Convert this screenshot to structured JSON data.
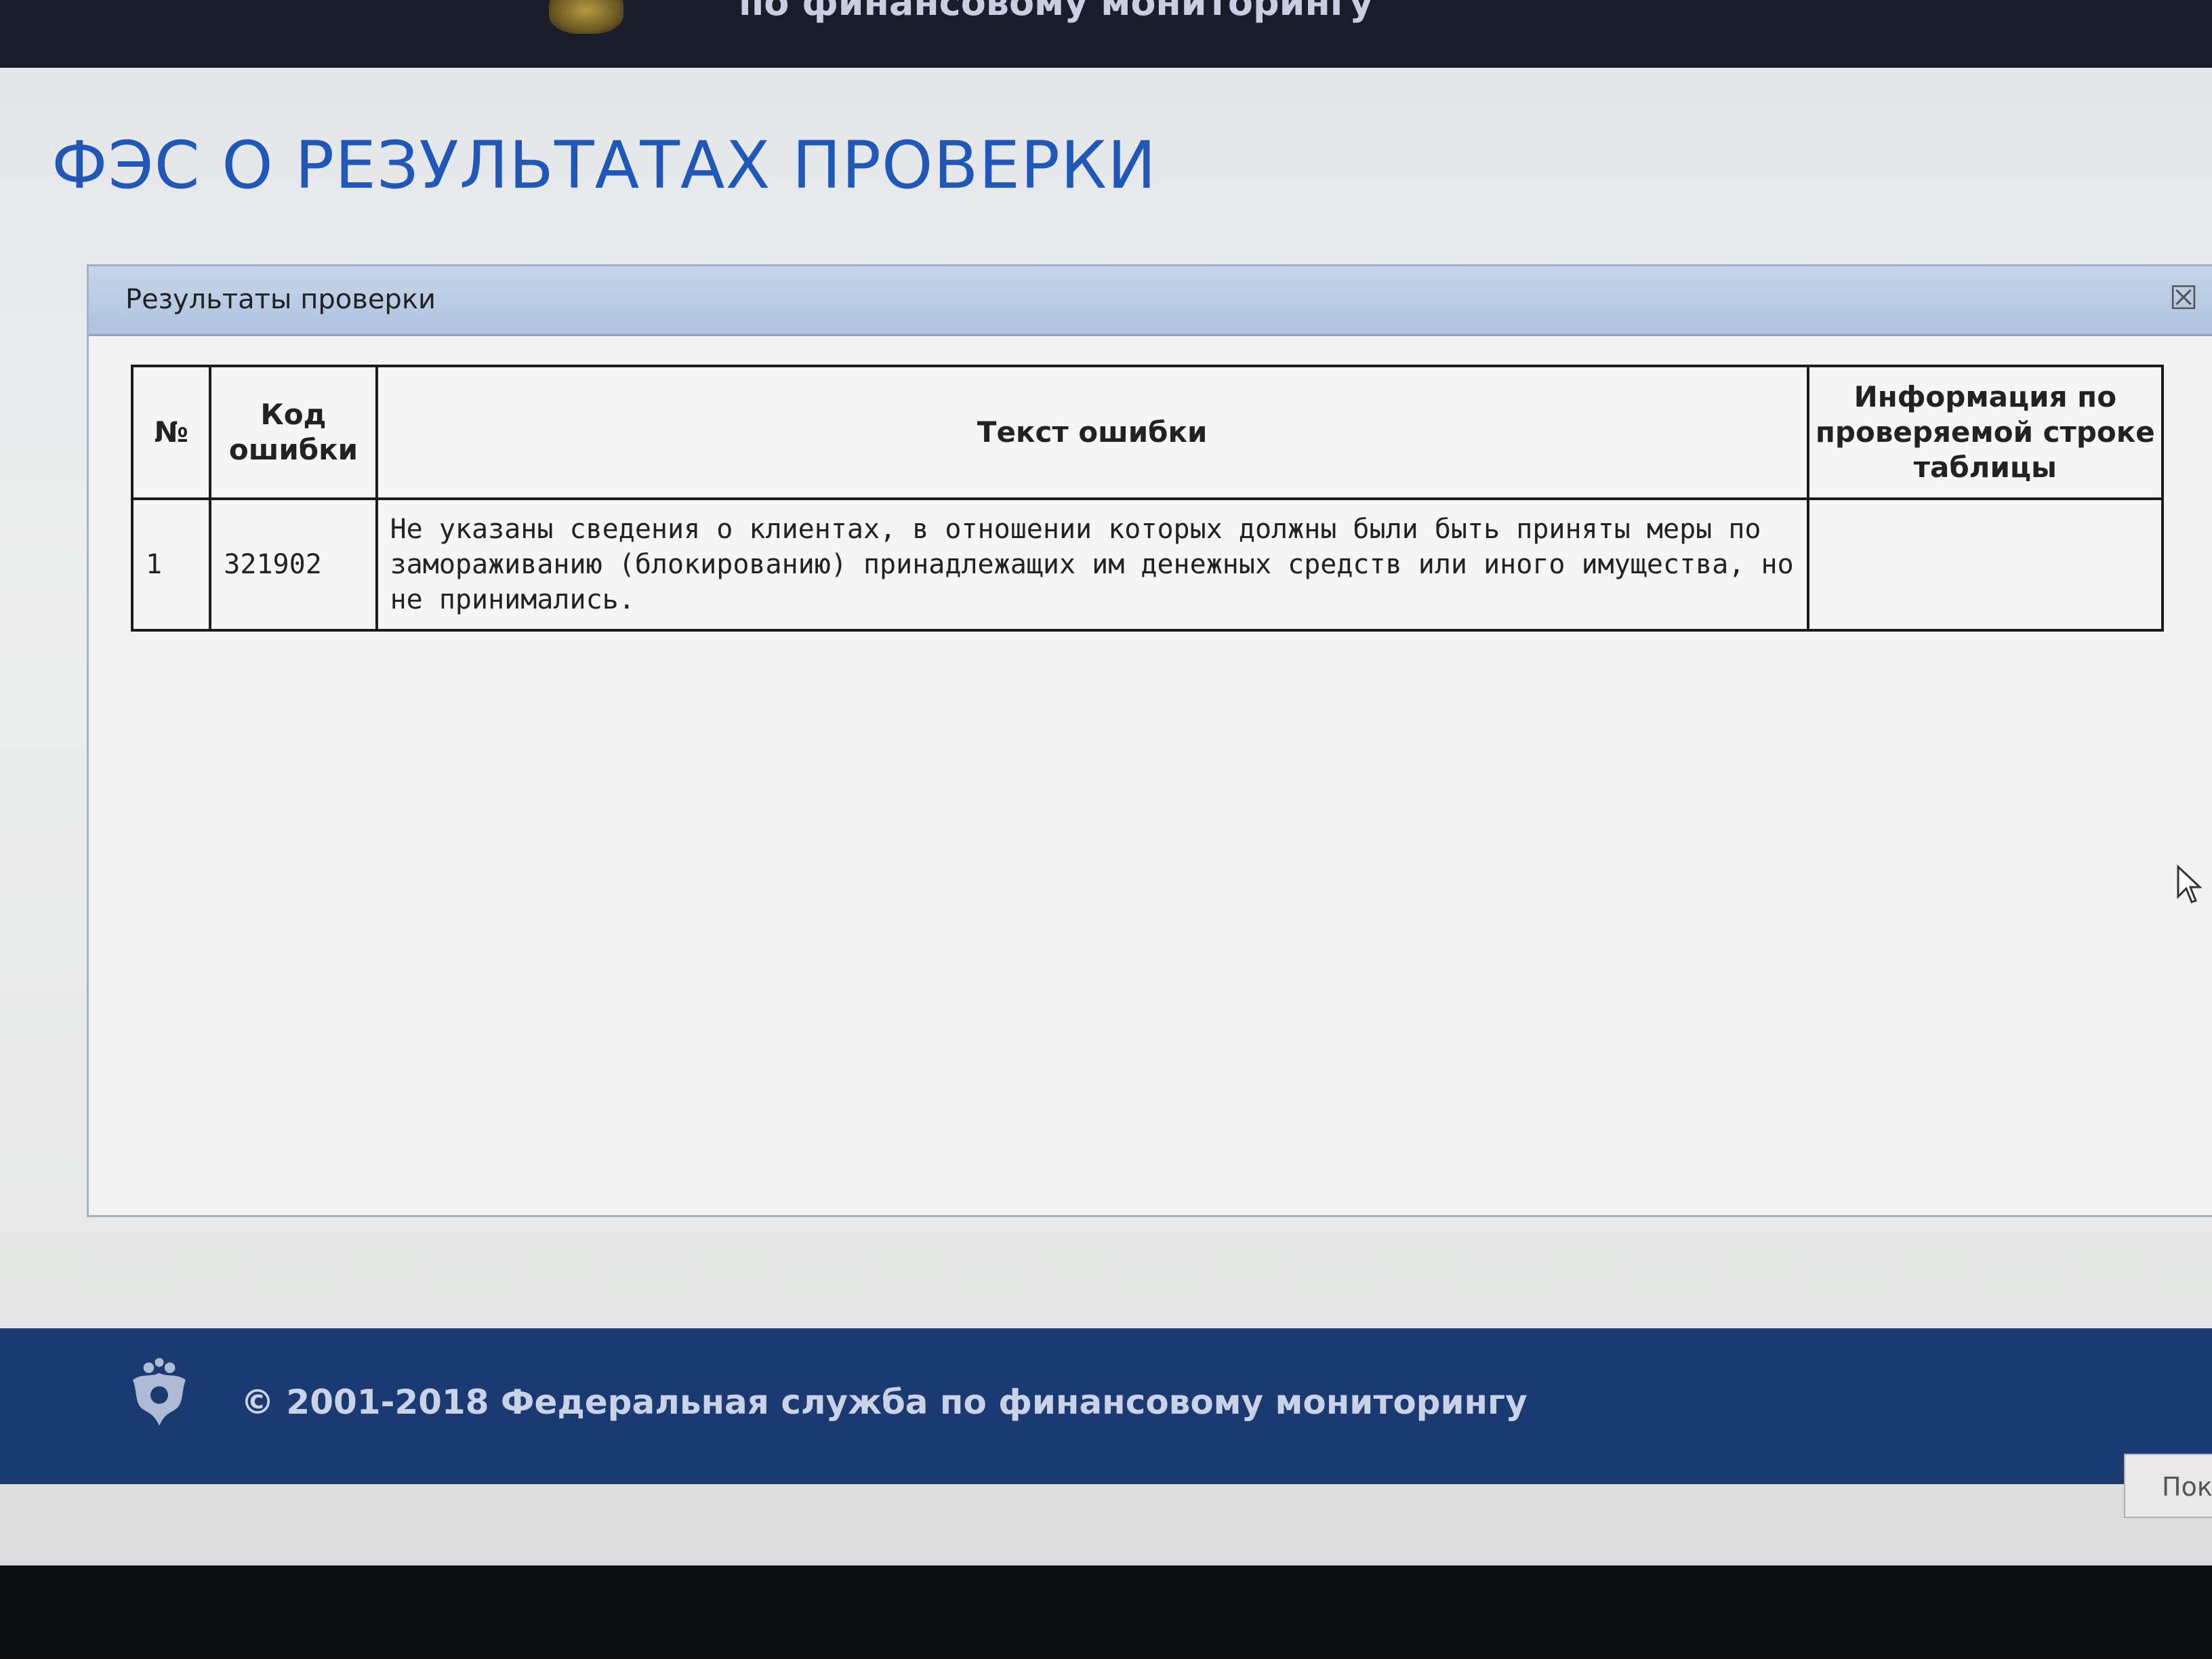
{
  "header": {
    "service_name": "по финансовому мониторингу"
  },
  "page": {
    "title": "ФЭС О РЕЗУЛЬТАТАХ ПРОВЕРКИ"
  },
  "dialog": {
    "title": "Результаты проверки",
    "close_label": "☒",
    "table": {
      "headers": [
        "№",
        "Код ошибки",
        "Текст ошибки",
        "Информация по проверяемой строке таблицы"
      ],
      "rows": [
        {
          "num": "1",
          "code": "321902",
          "text": "Не указаны сведения о клиентах, в отношении которых должны были быть приняты меры по замораживанию (блокированию) принадлежащих им денежных средств или иного имущества, но не принимались.",
          "info": ""
        }
      ]
    }
  },
  "footer": {
    "copyright": "© 2001-2018 Федеральная служба по финансовому мониторингу",
    "emblem": "double-headed-eagle-icon"
  },
  "bottom_button": {
    "label": "Пок"
  },
  "colors": {
    "title_blue": "#1f58b8",
    "footer_navy": "#1c3a72",
    "dialog_titlebar": "#b9cbe3"
  }
}
